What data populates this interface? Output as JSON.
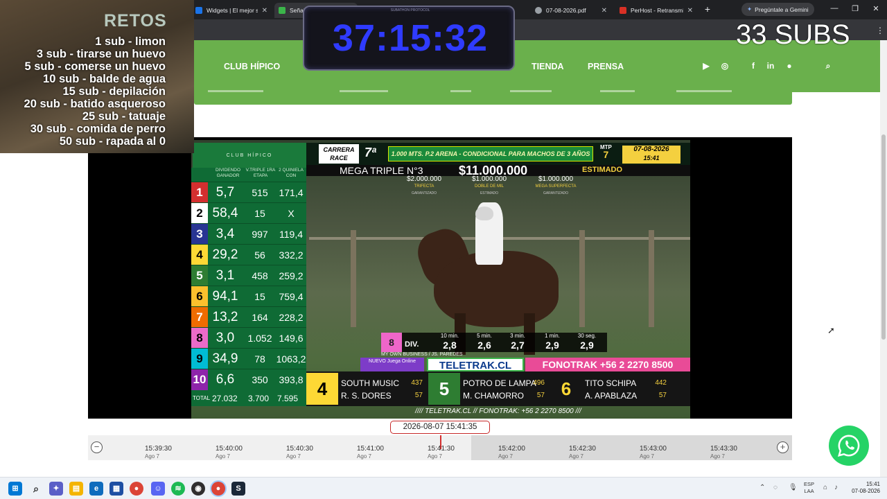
{
  "browser": {
    "tabs": [
      {
        "title": "Widgets | El mejor sc",
        "active": false,
        "color": "#1a73e8"
      },
      {
        "title": "Señal",
        "active": true,
        "color": "#3bb54a"
      },
      {
        "title": "07-08-2026.pdf",
        "active": false,
        "color": "#9aa0a6"
      },
      {
        "title": "PerHost - Retransmi",
        "active": false,
        "color": "#d93025"
      }
    ],
    "new_tab": "+",
    "gemini_button": "Pregúntale a Gemini"
  },
  "overlay": {
    "retos_title": "RETOS",
    "retos": [
      "1 sub - limon",
      "3 sub - tirarse un huevo",
      "5 sub - comerse un huevo",
      "10 sub - balde de agua",
      "15 sub - depilación",
      "20 sub - batido asqueroso",
      "25 sub - tatuaje",
      "30 sub - comida de perro",
      "50 sub - rapada al 0"
    ],
    "timer_label": "SUBATHON PROTOCOL",
    "timer": "37:15:32",
    "subs": "33 SUBS"
  },
  "site_nav": {
    "links": [
      "CLUB HÍPICO",
      "TIENDA",
      "PRENSA"
    ],
    "icons": [
      "youtube-icon",
      "instagram-icon",
      "facebook-icon",
      "linkedin-icon",
      "spotify-icon",
      "search-icon"
    ]
  },
  "broadcast": {
    "club": "CLUB HÍPICO",
    "headers": {
      "div": "DIVIDENDO GANADOR",
      "triple": "V.TRIPLE 1RA ETAPA",
      "quin": "2 QUINIELA CON"
    },
    "runners": [
      {
        "n": "1",
        "win": "5,7",
        "triple": "515",
        "quin": "171,4",
        "bg": "#d32f2f",
        "fg": "#ffffff"
      },
      {
        "n": "2",
        "win": "58,4",
        "triple": "15",
        "quin": "X",
        "bg": "#ffffff",
        "fg": "#000000"
      },
      {
        "n": "3",
        "win": "3,4",
        "triple": "997",
        "quin": "119,4",
        "bg": "#283593",
        "fg": "#ffffff"
      },
      {
        "n": "4",
        "win": "29,2",
        "triple": "56",
        "quin": "332,2",
        "bg": "#fdd835",
        "fg": "#000000"
      },
      {
        "n": "5",
        "win": "3,1",
        "triple": "458",
        "quin": "259,2",
        "bg": "#2e7d32",
        "fg": "#ffffff"
      },
      {
        "n": "6",
        "win": "94,1",
        "triple": "15",
        "quin": "759,4",
        "bg": "#fbc02d",
        "fg": "#000000"
      },
      {
        "n": "7",
        "win": "13,2",
        "triple": "164",
        "quin": "228,2",
        "bg": "#ef6c00",
        "fg": "#ffffff"
      },
      {
        "n": "8",
        "win": "3,0",
        "triple": "1.052",
        "quin": "149,6",
        "bg": "#ec6bc9",
        "fg": "#000000"
      },
      {
        "n": "9",
        "win": "34,9",
        "triple": "78",
        "quin": "1063,2",
        "bg": "#00bcd4",
        "fg": "#000000"
      },
      {
        "n": "10",
        "win": "6,6",
        "triple": "350",
        "quin": "393,8",
        "bg": "#8e24aa",
        "fg": "#ffffff"
      }
    ],
    "total": {
      "label": "TOTAL",
      "win": "27.032",
      "triple": "3.700",
      "quin": "7.595"
    },
    "carrera": "CARRERA RACE",
    "race_number": "7ª",
    "race_desc": "1.000 MTS. P.2 ARENA - CONDICIONAL PARA MACHOS DE 3 AÑOS NO GANADORES",
    "mtp_label": "MTP",
    "mtp_value": "7",
    "date": "07-08-2026",
    "time": "15:41",
    "mega_label": "MEGA TRIPLE N°3",
    "mega_amount": "$11.000.000",
    "mega_est": "ESTIMADO",
    "pools": [
      {
        "amount": "$2.000.000",
        "name": "TRIFECTA",
        "note": "GARANTIZADO"
      },
      {
        "amount": "$1.000.000",
        "name": "DOBLE DE MIL",
        "note": "ESTIMADO"
      },
      {
        "amount": "$1.000.000",
        "name": "MEGA SUPERFECTA",
        "note": "GARANTIZADO"
      }
    ],
    "div_horse": "8",
    "div_label": "DIV.",
    "div_headers": [
      "10 min.",
      "5 min.",
      "3 min.",
      "1 min.",
      "30 seg."
    ],
    "div_values": [
      "2,8",
      "2,6",
      "2,7",
      "2,9",
      "2,9"
    ],
    "owner_line": "MY OWN BUSINESS / JS. PAREDES",
    "nuevo": "NUEVO Juega Online",
    "teletrak": "TELETRAK.CL",
    "fonotrak": "FONOTRAK +56 2 2270 8500",
    "places": [
      {
        "n": "4",
        "horse": "SOUTH MUSIC",
        "jockey": "R. S. DORES",
        "a": "437",
        "b": "57",
        "bg": "#fdd835",
        "fg": "#000000"
      },
      {
        "n": "5",
        "horse": "POTRO DE LAMPA",
        "jockey": "M. CHAMORRO",
        "a": "496",
        "b": "57",
        "bg": "#2e7d32",
        "fg": "#ffffff"
      },
      {
        "n": "6",
        "horse": "TITO SCHIPA",
        "jockey": "A. APABLAZA",
        "a": "442",
        "b": "57",
        "bg": "#151515",
        "fg": "#fdd835"
      }
    ],
    "footer": "//// TELETRAK.CL // FONOTRAK: +56 2 2270 8500 ///"
  },
  "timeline": {
    "current": "2026-08-07 15:41:35",
    "ticks": [
      {
        "time": "15:39:30",
        "date": "Ago 7"
      },
      {
        "time": "15:40:00",
        "date": "Ago 7"
      },
      {
        "time": "15:40:30",
        "date": "Ago 7"
      },
      {
        "time": "15:41:00",
        "date": "Ago 7"
      },
      {
        "time": "15:41:30",
        "date": "Ago 7"
      },
      {
        "time": "15:42:00",
        "date": "Ago 7"
      },
      {
        "time": "15:42:30",
        "date": "Ago 7"
      },
      {
        "time": "15:43:00",
        "date": "Ago 7"
      },
      {
        "time": "15:43:30",
        "date": "Ago 7"
      }
    ],
    "minus": "−",
    "plus": "+"
  },
  "taskbar": {
    "lang_top": "ESP",
    "lang_bottom": "LAA",
    "clock_time": "15:41",
    "clock_date": "07-08-2026"
  }
}
